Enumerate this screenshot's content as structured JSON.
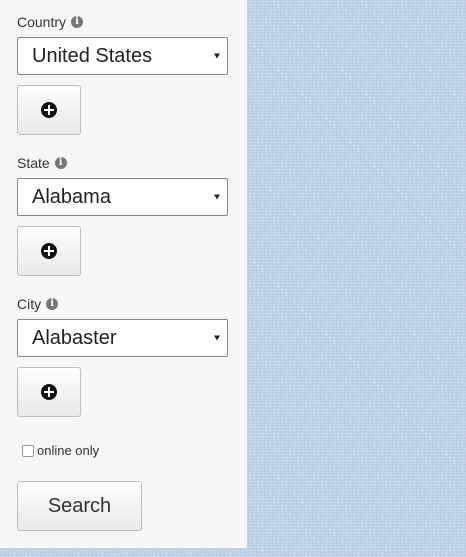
{
  "filters": {
    "country": {
      "label": "Country",
      "selected": "United States"
    },
    "state": {
      "label": "State",
      "selected": "Alabama"
    },
    "city": {
      "label": "City",
      "selected": "Alabaster"
    }
  },
  "online_only": {
    "label": "online only",
    "checked": false
  },
  "search_button": {
    "label": "Search"
  },
  "icons": {
    "info": "info-circle-icon",
    "add": "plus-circle-icon",
    "dropdown": "caret-down-icon"
  },
  "colors": {
    "panel_background": "#f4f6f8",
    "page_background": "#bcd2e4"
  }
}
